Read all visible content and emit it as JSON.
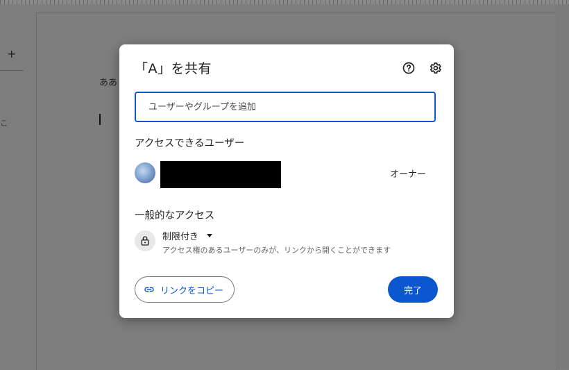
{
  "background": {
    "doc_text": "ああ",
    "side_text": "こ",
    "plus_label": "+"
  },
  "dialog": {
    "title": "「A」を共有",
    "help_icon": "help-icon",
    "settings_icon": "gear-icon",
    "add_input": {
      "placeholder": "ユーザーやグループを追加",
      "value": ""
    },
    "access_users_heading": "アクセスできるユーザー",
    "owner": {
      "role": "オーナー"
    },
    "general_access_heading": "一般的なアクセス",
    "restriction": {
      "label": "制限付き",
      "description": "アクセス権のあるユーザーのみが、リンクから開くことができます"
    },
    "copy_link_label": "リンクをコピー",
    "done_label": "完了"
  },
  "colors": {
    "accent": "#0b57d0",
    "overlay": "#7d7d7d"
  }
}
